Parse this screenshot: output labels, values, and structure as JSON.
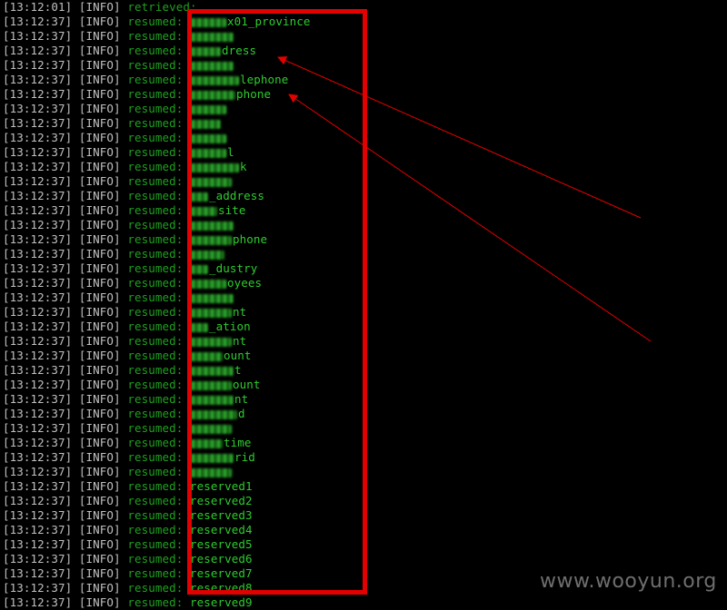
{
  "log": {
    "first_line": {
      "timestamp": "[13:12:01]",
      "level": "[INFO]",
      "message": "retrieved:"
    },
    "timestamp": "[13:12:37]",
    "level": "[INFO]",
    "message": "resumed:",
    "entries": [
      {
        "blurred_width": 40,
        "visible_suffix": "x01_province"
      },
      {
        "blurred_width": 48,
        "visible_suffix": ""
      },
      {
        "blurred_width": 34,
        "visible_suffix": "dress"
      },
      {
        "blurred_width": 48,
        "visible_suffix": ""
      },
      {
        "blurred_width": 54,
        "visible_suffix": "lephone"
      },
      {
        "blurred_width": 50,
        "visible_suffix": "phone"
      },
      {
        "blurred_width": 40,
        "visible_suffix": ""
      },
      {
        "blurred_width": 34,
        "visible_suffix": ""
      },
      {
        "blurred_width": 40,
        "visible_suffix": ""
      },
      {
        "blurred_width": 40,
        "visible_suffix": "l"
      },
      {
        "blurred_width": 54,
        "visible_suffix": "k"
      },
      {
        "blurred_width": 46,
        "visible_suffix": ""
      },
      {
        "blurred_width": 20,
        "visible_suffix": "_address"
      },
      {
        "blurred_width": 30,
        "visible_suffix": "site"
      },
      {
        "blurred_width": 48,
        "visible_suffix": ""
      },
      {
        "blurred_width": 46,
        "visible_suffix": "phone"
      },
      {
        "blurred_width": 38,
        "visible_suffix": ""
      },
      {
        "blurred_width": 20,
        "visible_suffix": "_dustry"
      },
      {
        "blurred_width": 40,
        "visible_suffix": "oyees"
      },
      {
        "blurred_width": 48,
        "visible_suffix": ""
      },
      {
        "blurred_width": 46,
        "visible_suffix": "nt"
      },
      {
        "blurred_width": 20,
        "visible_suffix": "_ation"
      },
      {
        "blurred_width": 46,
        "visible_suffix": "nt"
      },
      {
        "blurred_width": 36,
        "visible_suffix": "ount"
      },
      {
        "blurred_width": 48,
        "visible_suffix": "t"
      },
      {
        "blurred_width": 46,
        "visible_suffix": "ount"
      },
      {
        "blurred_width": 48,
        "visible_suffix": "nt"
      },
      {
        "blurred_width": 52,
        "visible_suffix": "d"
      },
      {
        "blurred_width": 46,
        "visible_suffix": ""
      },
      {
        "blurred_width": 36,
        "visible_suffix": "time"
      },
      {
        "blurred_width": 48,
        "visible_suffix": "rid"
      },
      {
        "blurred_width": 46,
        "visible_suffix": ""
      },
      {
        "blurred_width": 0,
        "visible_suffix": "reserved1"
      },
      {
        "blurred_width": 0,
        "visible_suffix": "reserved2"
      },
      {
        "blurred_width": 0,
        "visible_suffix": "reserved3"
      },
      {
        "blurred_width": 0,
        "visible_suffix": "reserved4"
      },
      {
        "blurred_width": 0,
        "visible_suffix": "reserved5"
      },
      {
        "blurred_width": 0,
        "visible_suffix": "reserved6"
      },
      {
        "blurred_width": 0,
        "visible_suffix": "reserved7"
      },
      {
        "blurred_width": 0,
        "visible_suffix": "reserved8"
      },
      {
        "blurred_width": 0,
        "visible_suffix": "reserved9"
      }
    ]
  },
  "annotation": {
    "box_color": "#e30000",
    "arrow_color": "#e30000"
  },
  "watermark": {
    "text": "www.wooyun.org"
  },
  "colors": {
    "background": "#000000",
    "meta_text": "#c0c0c0",
    "log_text": "#1fa01f",
    "value_text": "#2ecc2e"
  }
}
